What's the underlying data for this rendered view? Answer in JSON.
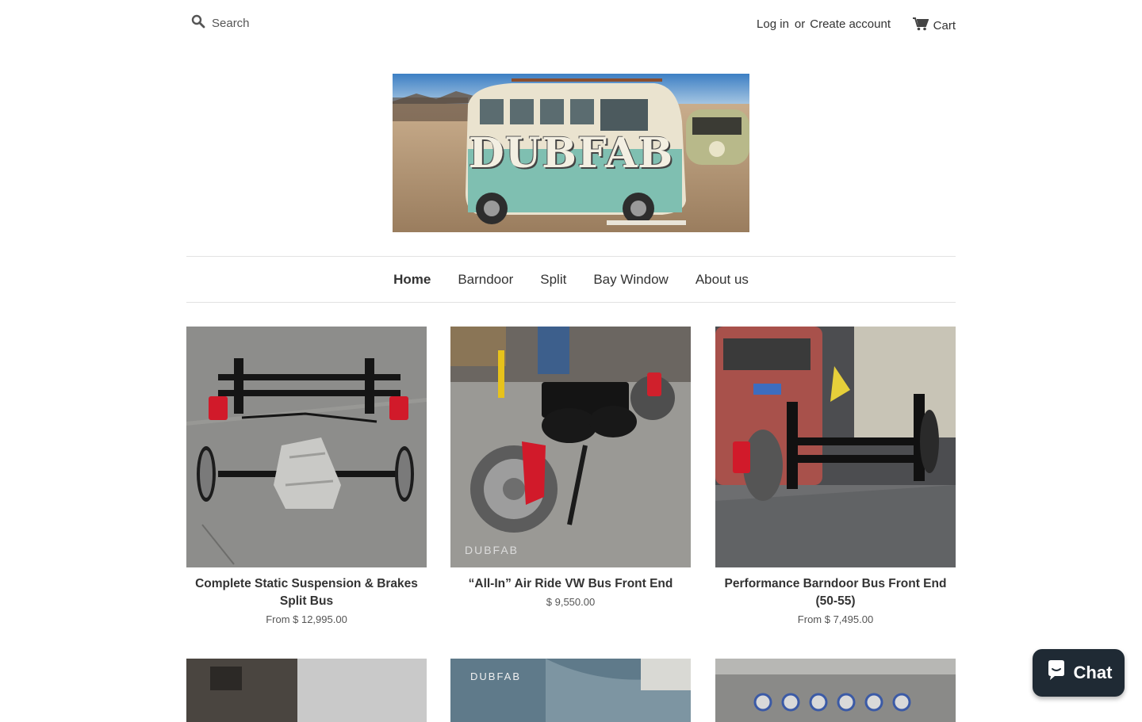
{
  "header": {
    "search_placeholder": "Search",
    "login_label": "Log in",
    "or_label": "or",
    "create_account_label": "Create account",
    "cart_label": "Cart"
  },
  "logo": {
    "text": "DUBFAB"
  },
  "nav": {
    "items": [
      {
        "label": "Home",
        "active": true
      },
      {
        "label": "Barndoor"
      },
      {
        "label": "Split"
      },
      {
        "label": "Bay Window"
      },
      {
        "label": "About us"
      }
    ]
  },
  "products": [
    {
      "title": "Complete Static Suspension & Brakes Split Bus",
      "price": "From $ 12,995.00"
    },
    {
      "title": "“All-In” Air Ride VW Bus Front End",
      "price": "$ 9,550.00"
    },
    {
      "title": "Performance Barndoor Bus Front End (50-55)",
      "price": "From $ 7,495.00"
    }
  ],
  "watermark": "DUBFAB",
  "chat": {
    "label": "Chat"
  }
}
